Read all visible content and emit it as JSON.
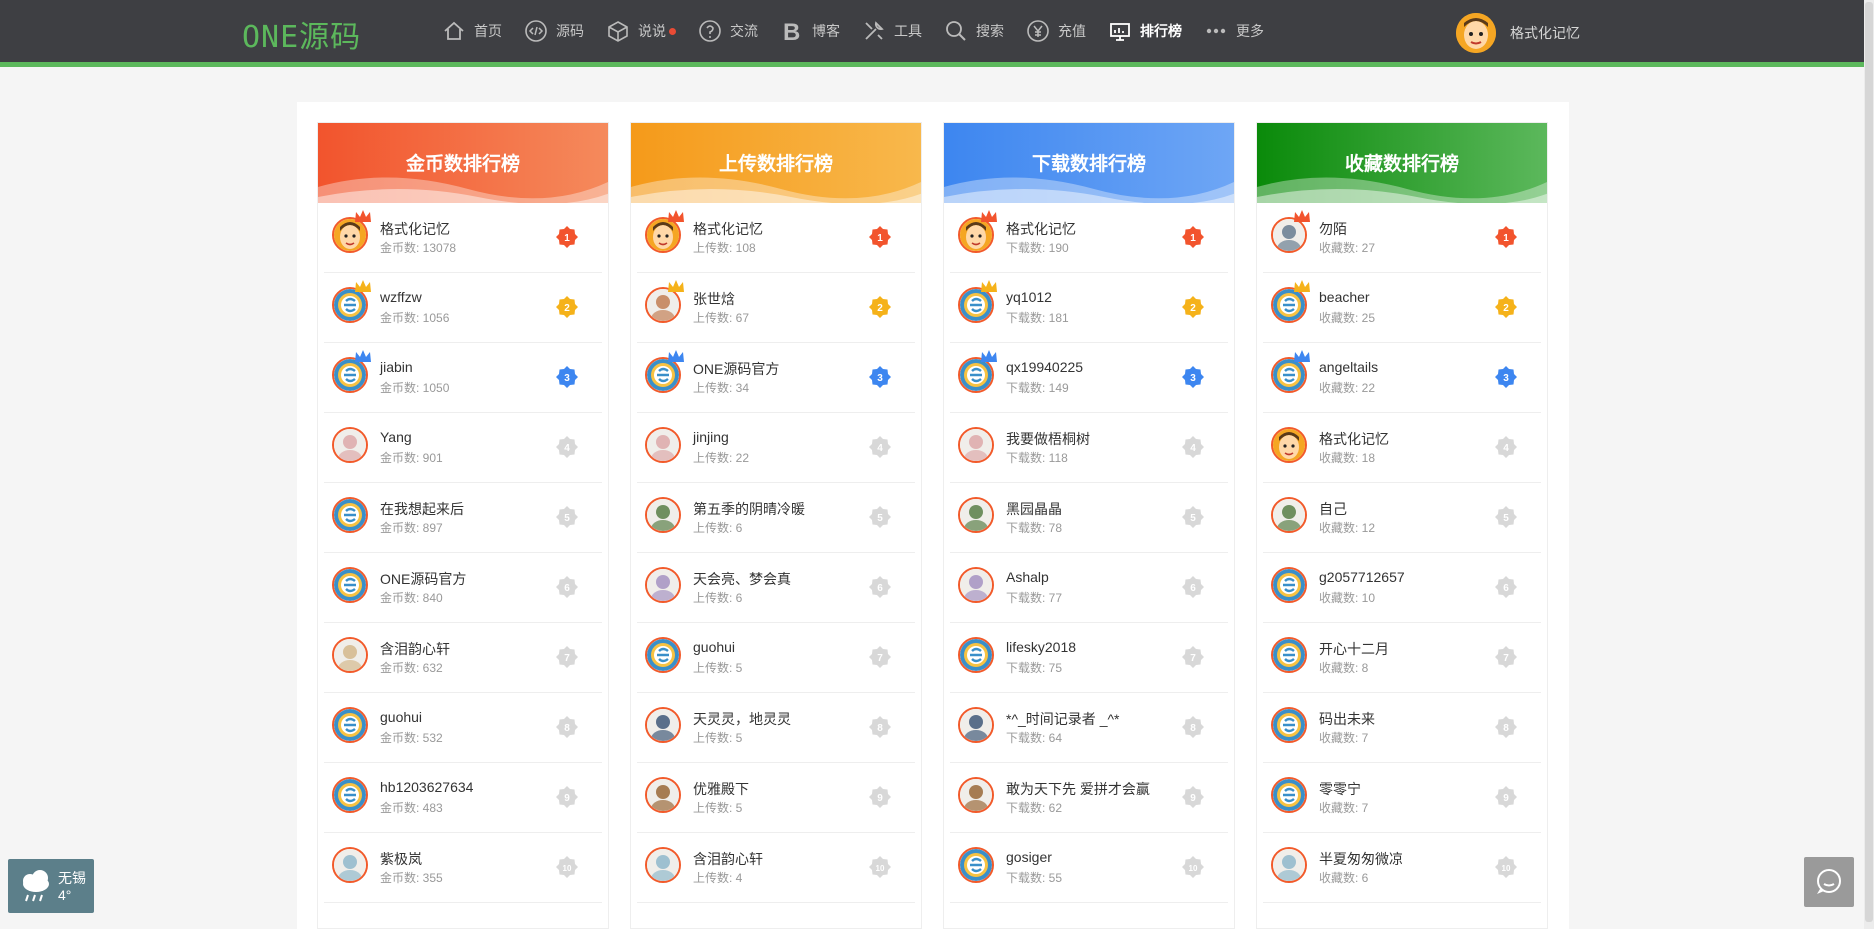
{
  "brand": {
    "logo": "ONE源码",
    "accent": "#5cb85c"
  },
  "nav": [
    {
      "label": "首页",
      "icon": "home-icon"
    },
    {
      "label": "源码",
      "icon": "code-icon"
    },
    {
      "label": "说说",
      "icon": "box-icon",
      "dot": true
    },
    {
      "label": "交流",
      "icon": "question-icon"
    },
    {
      "label": "博客",
      "icon": "blog-b-icon"
    },
    {
      "label": "工具",
      "icon": "tools-icon"
    },
    {
      "label": "搜索",
      "icon": "search-icon"
    },
    {
      "label": "充值",
      "icon": "yen-icon"
    },
    {
      "label": "排行榜",
      "icon": "ranking-board-icon",
      "active": true
    },
    {
      "label": "更多",
      "icon": "more-dots-icon"
    }
  ],
  "user": {
    "name": "格式化记忆"
  },
  "boards": [
    {
      "title": "金币数排行榜",
      "color1": "#f2542d",
      "color2": "#f58a5c",
      "entries": [
        {
          "name": "格式化记忆",
          "stat": "金币数: 13078",
          "avatar": "cartoon",
          "rank": "1"
        },
        {
          "name": "wzffzw",
          "stat": "金币数: 1056",
          "avatar": "default",
          "rank": "2"
        },
        {
          "name": "jiabin",
          "stat": "金币数: 1050",
          "avatar": "default",
          "rank": "3"
        },
        {
          "name": "Yang",
          "stat": "金币数: 901",
          "avatar": "photo",
          "rank": "4"
        },
        {
          "name": "在我想起来后",
          "stat": "金币数: 897",
          "avatar": "default",
          "rank": "5"
        },
        {
          "name": "ONE源码官方",
          "stat": "金币数: 840",
          "avatar": "default",
          "rank": "6"
        },
        {
          "name": "含泪韵心轩",
          "stat": "金币数: 632",
          "avatar": "photo",
          "rank": "7"
        },
        {
          "name": "guohui",
          "stat": "金币数: 532",
          "avatar": "default",
          "rank": "8"
        },
        {
          "name": "hb1203627634",
          "stat": "金币数: 483",
          "avatar": "default",
          "rank": "9"
        },
        {
          "name": "紫极岚",
          "stat": "金币数: 355",
          "avatar": "photo",
          "rank": "10"
        }
      ]
    },
    {
      "title": "上传数排行榜",
      "color1": "#f59a1a",
      "color2": "#f8b84c",
      "entries": [
        {
          "name": "格式化记忆",
          "stat": "上传数: 108",
          "avatar": "cartoon",
          "rank": "1"
        },
        {
          "name": "张世焓",
          "stat": "上传数: 67",
          "avatar": "photo",
          "rank": "2"
        },
        {
          "name": "ONE源码官方",
          "stat": "上传数: 34",
          "avatar": "default",
          "rank": "3"
        },
        {
          "name": "jinjing",
          "stat": "上传数: 22",
          "avatar": "photo",
          "rank": "4"
        },
        {
          "name": "第五季的阴晴冷暖",
          "stat": "上传数: 6",
          "avatar": "photo",
          "rank": "5"
        },
        {
          "name": "天会亮、梦会真",
          "stat": "上传数: 6",
          "avatar": "photo",
          "rank": "6"
        },
        {
          "name": "guohui",
          "stat": "上传数: 5",
          "avatar": "default",
          "rank": "7"
        },
        {
          "name": "天灵灵，地灵灵",
          "stat": "上传数: 5",
          "avatar": "photo",
          "rank": "8"
        },
        {
          "name": "优雅殿下",
          "stat": "上传数: 5",
          "avatar": "photo",
          "rank": "9"
        },
        {
          "name": "含泪韵心轩",
          "stat": "上传数: 4",
          "avatar": "photo",
          "rank": "10"
        }
      ]
    },
    {
      "title": "下载数排行榜",
      "color1": "#3d86f0",
      "color2": "#6ea6f5",
      "entries": [
        {
          "name": "格式化记忆",
          "stat": "下载数: 190",
          "avatar": "cartoon",
          "rank": "1"
        },
        {
          "name": "yq1012",
          "stat": "下载数: 181",
          "avatar": "default",
          "rank": "2"
        },
        {
          "name": "qx19940225",
          "stat": "下载数: 149",
          "avatar": "default",
          "rank": "3"
        },
        {
          "name": "我要做梧桐树",
          "stat": "下载数: 118",
          "avatar": "photo",
          "rank": "4"
        },
        {
          "name": "黑园晶晶",
          "stat": "下载数: 78",
          "avatar": "photo",
          "rank": "5"
        },
        {
          "name": "Ashalp",
          "stat": "下载数: 77",
          "avatar": "photo",
          "rank": "6"
        },
        {
          "name": "lifesky2018",
          "stat": "下载数: 75",
          "avatar": "default",
          "rank": "7"
        },
        {
          "name": "*^_时间记录者 _^*",
          "stat": "下载数: 64",
          "avatar": "photo",
          "rank": "8"
        },
        {
          "name": "敢为天下先 爱拼才会赢",
          "stat": "下载数: 62",
          "avatar": "photo",
          "rank": "9"
        },
        {
          "name": "gosiger",
          "stat": "下载数: 55",
          "avatar": "default",
          "rank": "10"
        }
      ]
    },
    {
      "title": "收藏数排行榜",
      "color1": "#0a8a0a",
      "color2": "#5cb85c",
      "entries": [
        {
          "name": "勿陌",
          "stat": "收藏数: 27",
          "avatar": "photo",
          "rank": "1"
        },
        {
          "name": "beacher",
          "stat": "收藏数: 25",
          "avatar": "default",
          "rank": "2"
        },
        {
          "name": "angeltails",
          "stat": "收藏数: 22",
          "avatar": "default",
          "rank": "3"
        },
        {
          "name": "格式化记忆",
          "stat": "收藏数: 18",
          "avatar": "cartoon",
          "rank": "4"
        },
        {
          "name": "自己",
          "stat": "收藏数: 12",
          "avatar": "photo",
          "rank": "5"
        },
        {
          "name": "g2057712657",
          "stat": "收藏数: 10",
          "avatar": "default",
          "rank": "6"
        },
        {
          "name": "开心十二月",
          "stat": "收藏数: 8",
          "avatar": "default",
          "rank": "7"
        },
        {
          "name": "码出未来",
          "stat": "收藏数: 7",
          "avatar": "default",
          "rank": "8"
        },
        {
          "name": "零零宁",
          "stat": "收藏数: 7",
          "avatar": "default",
          "rank": "9"
        },
        {
          "name": "半夏匆匆微凉",
          "stat": "收藏数: 6",
          "avatar": "photo",
          "rank": "10"
        }
      ]
    }
  ],
  "weather": {
    "city": "无锡",
    "temp": "4°",
    "icon": "rain-cloud-icon"
  },
  "chat": {
    "icon": "chat-bubble-icon"
  }
}
